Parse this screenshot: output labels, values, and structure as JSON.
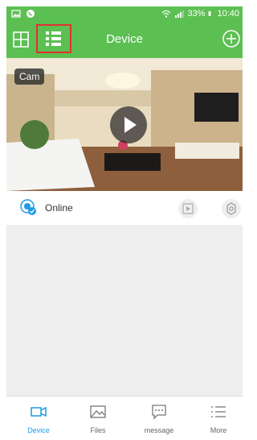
{
  "status_bar": {
    "battery": "33%",
    "time": "10:40",
    "left_icons": [
      "image-icon",
      "whatsapp-icon"
    ],
    "right_icons": [
      "wifi-icon",
      "signal-icon",
      "battery-icon"
    ]
  },
  "app_bar": {
    "title": "Device",
    "left_buttons": [
      "grid-view-icon",
      "list-view-icon"
    ],
    "right_button": "add-circle-icon",
    "accent_color": "#5cbf52",
    "highlight_color": "#e23030"
  },
  "device": {
    "name": "Cam",
    "status": "Online",
    "status_icon": "camera-online-icon",
    "actions": [
      "playback-icon",
      "settings-icon"
    ]
  },
  "bottom_nav": {
    "active_color": "#1e9be6",
    "items": [
      {
        "label": "Device",
        "icon": "video-camera-icon",
        "active": true
      },
      {
        "label": "Files",
        "icon": "image-icon",
        "active": false
      },
      {
        "label": "message",
        "icon": "message-icon",
        "active": false
      },
      {
        "label": "More",
        "icon": "more-list-icon",
        "active": false
      }
    ]
  }
}
